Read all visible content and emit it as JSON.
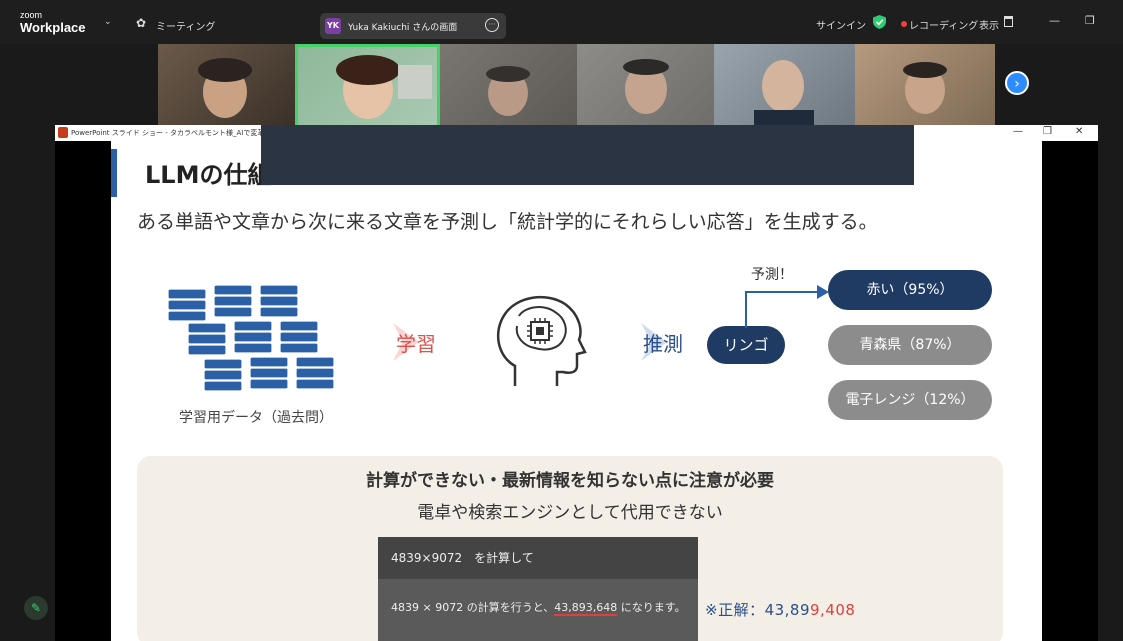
{
  "zoom": {
    "logo_small": "zoom",
    "logo_big": "Workplace",
    "meeting_label": "ミーティング",
    "speaker_initials": "YK",
    "speaker_label": "Yuka Kakiuchi さんの画面",
    "signin": "サインイン",
    "recording": "レコーディング",
    "view": "表示",
    "minimize_icon": "—",
    "restore_icon": "❐"
  },
  "ppt": {
    "window_title": "PowerPoint スライド ショー - タカラベルモント様_AIで変革",
    "close_icon": "✕"
  },
  "slide": {
    "title": "LLMの仕組",
    "lead": "ある単語や文章から次に来る文章を予測し「統計学的にそれらしい応答」を生成する。",
    "books_caption": "学習用データ（過去問）",
    "learn_label": "学習",
    "infer_label": "推測",
    "input_word": "リンゴ",
    "predict_label": "予測！",
    "candidates": [
      {
        "text": "赤い（95%）",
        "color": "#1f3a63"
      },
      {
        "text": "青森県（87%）",
        "color": "#8c8c8c"
      },
      {
        "text": "電子レンジ（12%）",
        "color": "#8c8c8c"
      }
    ],
    "note_title": "計算ができない・最新情報を知らない点に注意が必要",
    "note_sub": "電卓や検索エンジンとして代用できない",
    "chat_question": "4839×9072　を計算して",
    "chat_answer_pre": "4839 × 9072 の計算を行うと、",
    "chat_answer_value": "43,893,648",
    "chat_answer_post": " になります。",
    "correct_prefix": "※正解：43,89",
    "correct_highlight": "9,408"
  },
  "colors": {
    "accent_blue": "#2b5fa6",
    "learn_red": "#d9534f",
    "zoom_blue": "#2d8cff"
  }
}
